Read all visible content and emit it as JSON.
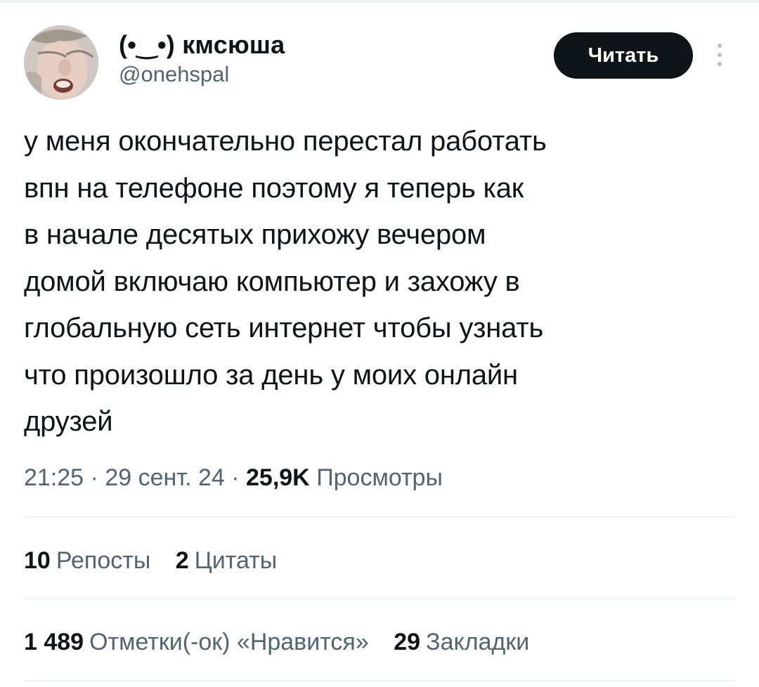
{
  "author": {
    "display_name": "(•‿•) кмсюша",
    "handle": "@onehspal"
  },
  "follow_button_label": "Читать",
  "tweet": {
    "text": "у меня окончательно перестал работать\nвпн на телефоне поэтому я теперь как\nв начале десятых прихожу вечером\nдомой включаю компьютер и захожу в\nглобальную сеть интернет чтобы узнать\nчто произошло за день у моих онлайн\nдрузей"
  },
  "meta": {
    "time": "21:25",
    "separator": " · ",
    "date": "29 сент. 24",
    "views_count": "25,9K",
    "views_label": "Просмотры"
  },
  "stats": {
    "reposts": {
      "count": "10",
      "label": "Репосты"
    },
    "quotes": {
      "count": "2",
      "label": "Цитаты"
    },
    "likes": {
      "count": "1 489",
      "label": "Отметки(-ок) «Нравится»"
    },
    "bookmarks": {
      "count": "29",
      "label": "Закладки"
    }
  },
  "colors": {
    "text": "#0f1419",
    "secondary": "#536471",
    "divider": "#eff3f4",
    "button_bg": "#0f1419"
  },
  "icons": [
    "avatar-photo",
    "more-options-icon"
  ]
}
